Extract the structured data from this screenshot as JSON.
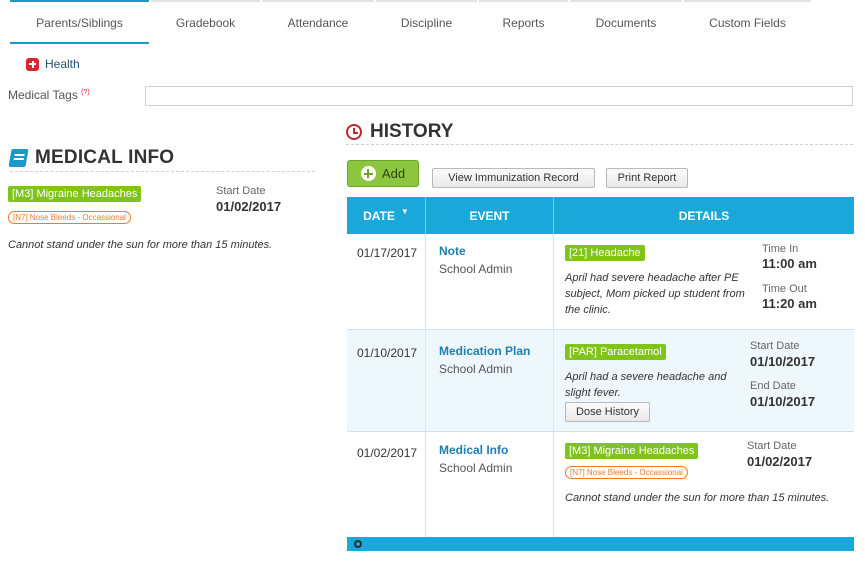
{
  "tabs": [
    {
      "label": "Parents/Siblings",
      "active": true
    },
    {
      "label": "Gradebook",
      "active": false
    },
    {
      "label": "Attendance",
      "active": false
    },
    {
      "label": "Discipline",
      "active": false
    },
    {
      "label": "Reports",
      "active": false
    },
    {
      "label": "Documents",
      "active": false
    },
    {
      "label": "Custom Fields",
      "active": false
    }
  ],
  "health": {
    "label": "Health",
    "icon": "medical-cross-icon"
  },
  "medical_tags": {
    "label": "Medical Tags",
    "marker": "(?)",
    "value": ""
  },
  "medical_info": {
    "title": "MEDICAL INFO",
    "icon": "book-icon",
    "condition_tag": "[M3] Migraine Headaches",
    "sub_tag": "[N7] Nose Bleeds - Occassional",
    "start_date_label": "Start Date",
    "start_date": "01/02/2017",
    "note": "Cannot stand under the sun for more than 15 minutes."
  },
  "history": {
    "title": "HISTORY",
    "icon": "clock-icon",
    "add_label": "Add",
    "view_immunization_label": "View Immunization Record",
    "print_report_label": "Print Report",
    "columns": {
      "date": "DATE",
      "event": "EVENT",
      "details": "DETAILS"
    },
    "rows": [
      {
        "date": "01/17/2017",
        "event": "Note",
        "by": "School Admin",
        "tag": "[21] Headache",
        "note": "April had severe headache after PE subject, Mom picked up student from the clinic.",
        "label1": "Time In",
        "value1": "11:00 am",
        "label2": "Time Out",
        "value2": "11:20 am"
      },
      {
        "date": "01/10/2017",
        "event": "Medication Plan",
        "by": "School Admin",
        "tag": "[PAR] Paracetamol",
        "note": "April had a severe headache and slight fever.",
        "button": "Dose History",
        "label1": "Start Date",
        "value1": "01/10/2017",
        "label2": "End Date",
        "value2": "01/10/2017"
      },
      {
        "date": "01/02/2017",
        "event": "Medical Info",
        "by": "School Admin",
        "tag": "[M3] Migraine Headaches",
        "sub_tag": "[N7] Nose Bleeds - Occassional",
        "note": "Cannot stand under the sun for more than 15 minutes.",
        "label1": "Start Date",
        "value1": "01/02/2017"
      }
    ]
  },
  "colors": {
    "accent": "#1aa8db",
    "tab_active": "#1a9ac9",
    "tag_green": "#7fc31b",
    "tag_orange": "#f07a2a",
    "add_button": "#8cc63f",
    "clock": "#c0282f"
  }
}
